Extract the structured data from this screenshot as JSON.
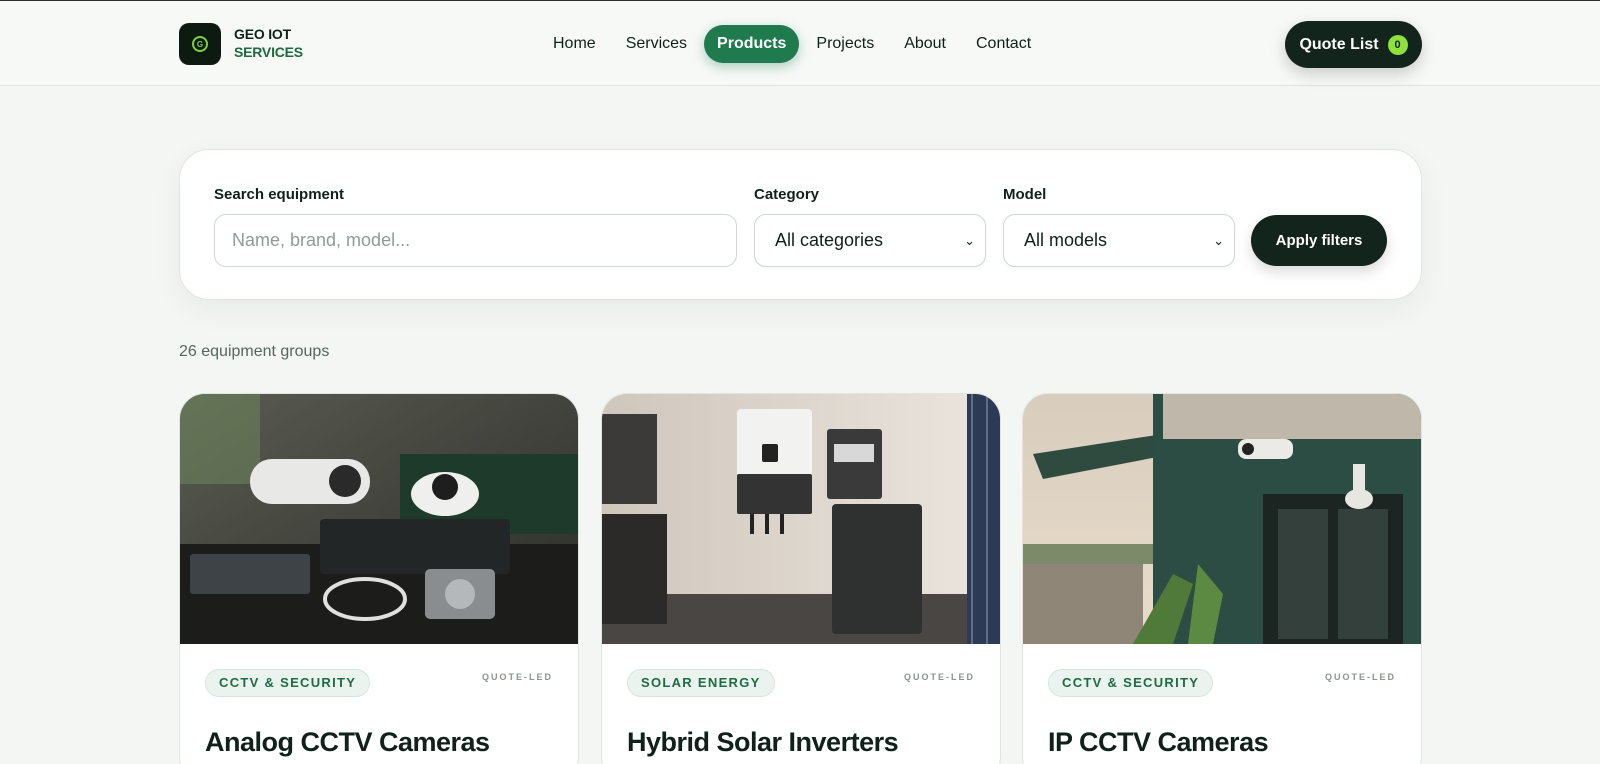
{
  "header": {
    "brand_line1": "GEO IOT",
    "brand_line2": "SERVICES",
    "logo_letter": "G",
    "nav": [
      {
        "label": "Home",
        "active": false
      },
      {
        "label": "Services",
        "active": false
      },
      {
        "label": "Products",
        "active": true
      },
      {
        "label": "Projects",
        "active": false
      },
      {
        "label": "About",
        "active": false
      },
      {
        "label": "Contact",
        "active": false
      }
    ],
    "quote_label": "Quote List",
    "quote_count": "0"
  },
  "filters": {
    "search_label": "Search equipment",
    "search_placeholder": "Name, brand, model...",
    "category_label": "Category",
    "category_value": "All categories",
    "model_label": "Model",
    "model_value": "All models",
    "apply_label": "Apply filters"
  },
  "results_count": "26 equipment groups",
  "cards": [
    {
      "tag": "CCTV & SECURITY",
      "badge": "QUOTE-LED",
      "title": "Analog CCTV Cameras",
      "image": "cctv-equipment-photo"
    },
    {
      "tag": "SOLAR ENERGY",
      "badge": "QUOTE-LED",
      "title": "Hybrid Solar Inverters",
      "image": "solar-inverter-photo"
    },
    {
      "tag": "CCTV & SECURITY",
      "badge": "QUOTE-LED",
      "title": "IP CCTV Cameras",
      "image": "ip-camera-building-photo"
    }
  ],
  "colors": {
    "accent": "#1f7a4d",
    "dark": "#12241c",
    "badge_green": "#8ee03a",
    "background": "#f3f6f3"
  }
}
